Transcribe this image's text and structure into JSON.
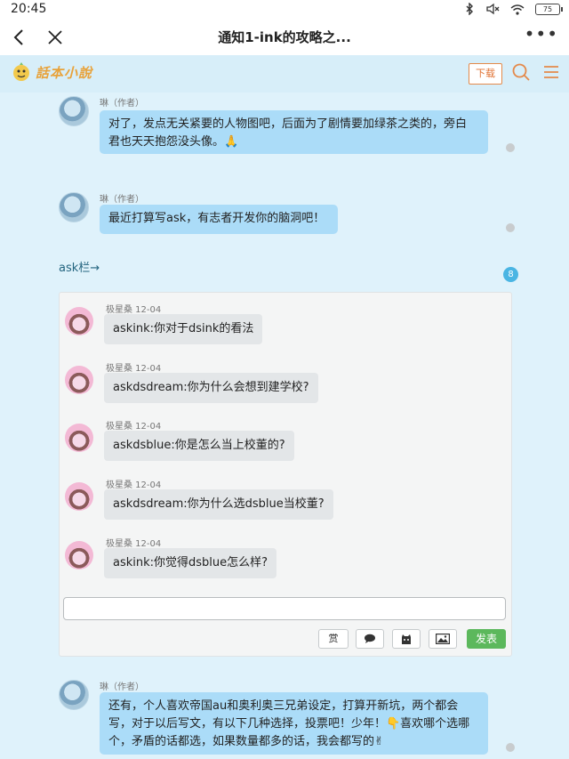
{
  "status_bar": {
    "time": "20:45",
    "battery": "75"
  },
  "nav": {
    "title": "通知1-ink的攻略之...",
    "more": "•••"
  },
  "site": {
    "logo_text": "話本小說",
    "download_label": "下载"
  },
  "posts": [
    {
      "author": "琳（作者）",
      "line1": "对了，发点无关紧要的人物图吧，后面为了剧情要加绿茶之类的，旁白",
      "line2": "君也天天抱怨没头像。🙏"
    },
    {
      "author": "琳（作者）",
      "line1": "最近打算写ask，有志者开发你的脑洞吧！"
    }
  ],
  "ask": {
    "link_text": "ask栏→",
    "count": "8",
    "items": [
      {
        "user": "极星桑 12-04",
        "text": "askink:你对于dsink的看法"
      },
      {
        "user": "极星桑 12-04",
        "text": "askdsdream:你为什么会想到建学校?"
      },
      {
        "user": "极星桑 12-04",
        "text": "askdsblue:你是怎么当上校董的?"
      },
      {
        "user": "极星桑 12-04",
        "text": "askdsdream:你为什么选dsblue当校董?"
      },
      {
        "user": "极星桑 12-04",
        "text": "askink:你觉得dsblue怎么样?"
      }
    ],
    "input_value": "",
    "reward_label": "赏",
    "send_label": "发表"
  },
  "post3": {
    "author": "琳（作者）",
    "line1": "还有，个人喜欢帝国au和奥利奥三兄弟设定，打算开新坑，两个都会",
    "line2": "写，对于以后写文，有以下几种选择，投票吧！少年！👇喜欢哪个选哪",
    "line3": "个，矛盾的话都选，如果数量都多的话，我会都写的✌"
  },
  "colors": {
    "bubble_author": "#abdcf8",
    "send_button": "#5cb85c",
    "badge": "#4ab5e3",
    "download_border": "#e48a4a"
  }
}
